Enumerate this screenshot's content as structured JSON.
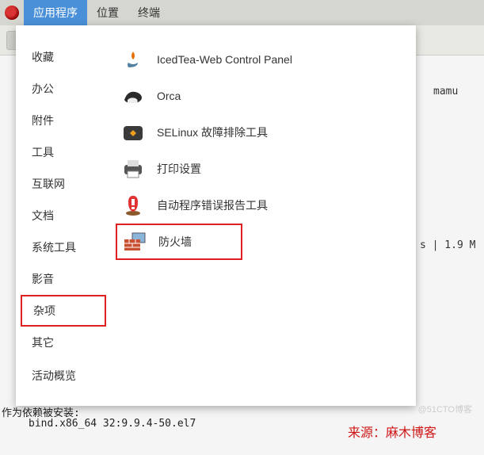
{
  "topbar": {
    "apps": "应用程序",
    "places": "位置",
    "terminal": "终端"
  },
  "bg": {
    "mamu": "mamu",
    "stats": "s | 1.9 M",
    "bindline": "bind.x86_64 32:9.9.4-50.el7",
    "deplabel": "作为依赖被安装:"
  },
  "sidebar": {
    "items": [
      "收藏",
      "办公",
      "附件",
      "工具",
      "互联网",
      "文档",
      "系统工具",
      "影音",
      "杂项",
      "其它"
    ],
    "overview": "活动概览"
  },
  "apps": {
    "items": [
      {
        "label": "IcedTea-Web Control Panel"
      },
      {
        "label": "Orca"
      },
      {
        "label": "SELinux 故障排除工具"
      },
      {
        "label": "打印设置"
      },
      {
        "label": "自动程序错误报告工具"
      },
      {
        "label": "防火墙"
      }
    ]
  },
  "source": "来源：麻木博客",
  "watermark": "@51CTO博客"
}
